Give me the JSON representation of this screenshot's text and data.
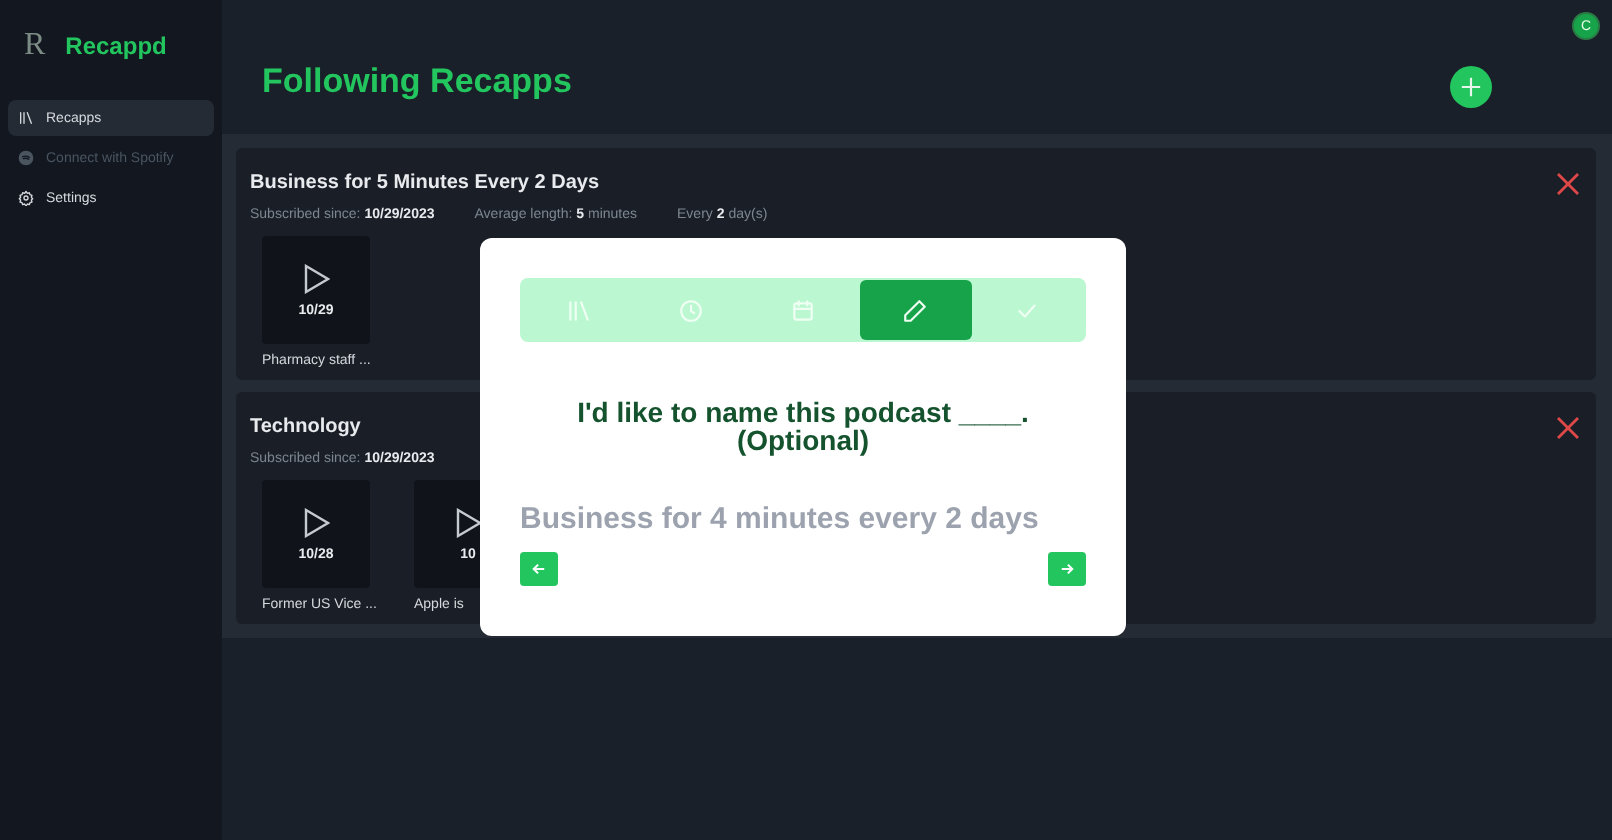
{
  "app": {
    "logo_letter": "R",
    "name": "Recappd"
  },
  "sidebar": {
    "items": [
      {
        "kind": "library",
        "label": "Recapps",
        "selected": true,
        "disabled": false
      },
      {
        "kind": "spotify",
        "label": "Connect with Spotify",
        "selected": false,
        "disabled": true
      },
      {
        "kind": "gear",
        "label": "Settings",
        "selected": false,
        "disabled": false
      }
    ]
  },
  "user": {
    "initial": "C"
  },
  "page": {
    "title": "Following Recapps"
  },
  "subscriptions": [
    {
      "title": "Business for 5 Minutes Every 2 Days",
      "meta": [
        {
          "label": "Subscribed since:",
          "value": "10/29/2023"
        },
        {
          "label": "Average length:",
          "value": "5",
          "suffix": "minutes"
        },
        {
          "label": "Every",
          "value": "2",
          "suffix": "day(s)"
        }
      ],
      "episodes": [
        {
          "date": "10/29",
          "title": "Pharmacy staff ..."
        }
      ]
    },
    {
      "title": "Technology",
      "meta": [
        {
          "label": "Subscribed since:",
          "value": "10/29/2023"
        }
      ],
      "episodes": [
        {
          "date": "10/28",
          "title": "Former US Vice ..."
        },
        {
          "date": "10",
          "title": "Apple is"
        }
      ]
    }
  ],
  "dialog": {
    "steps": [
      {
        "kind": "library",
        "selected": false
      },
      {
        "kind": "clock",
        "selected": false
      },
      {
        "kind": "calendar",
        "selected": false
      },
      {
        "kind": "pencil",
        "selected": true
      },
      {
        "kind": "check",
        "selected": false
      }
    ],
    "question_line1": "I'd like to name this podcast ____.",
    "question_line2": "(Optional)",
    "placeholder": "Business for 4 minutes every 2 days"
  }
}
